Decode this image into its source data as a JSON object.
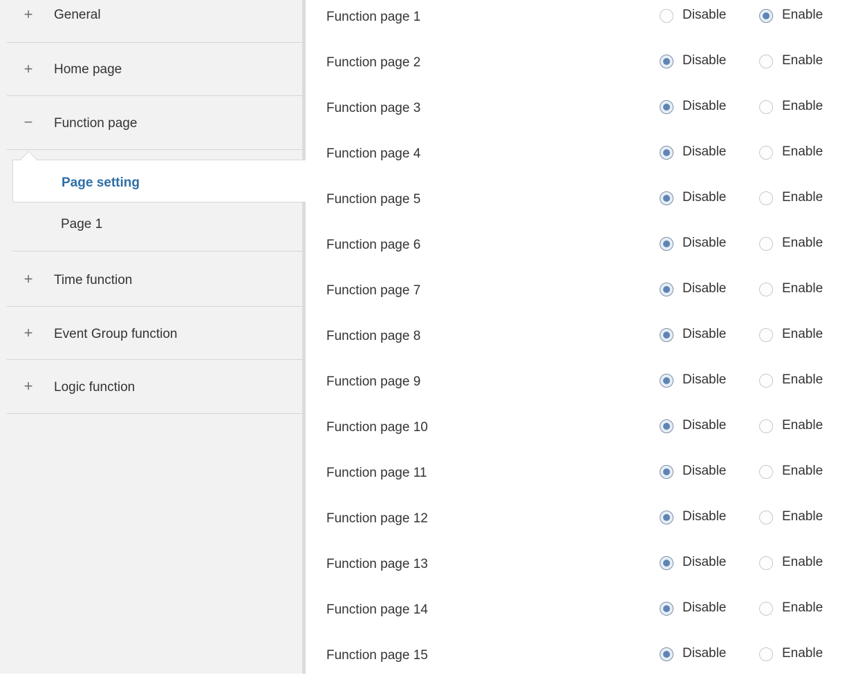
{
  "sidebar": {
    "items": [
      {
        "toggle": "+",
        "label": "General"
      },
      {
        "toggle": "+",
        "label": "Home page"
      },
      {
        "toggle": "−",
        "label": "Function page"
      },
      {
        "toggle": "+",
        "label": "Time function"
      },
      {
        "toggle": "+",
        "label": "Event Group function"
      },
      {
        "toggle": "+",
        "label": "Logic function"
      }
    ],
    "sub_items": [
      {
        "label": "Page setting",
        "selected": true
      },
      {
        "label": "Page 1",
        "selected": false
      }
    ]
  },
  "options": {
    "disable_label": "Disable",
    "enable_label": "Enable"
  },
  "rows": [
    {
      "label": "Function page 1",
      "value": "Enable"
    },
    {
      "label": "Function page 2",
      "value": "Disable"
    },
    {
      "label": "Function page 3",
      "value": "Disable"
    },
    {
      "label": "Function page 4",
      "value": "Disable"
    },
    {
      "label": "Function page 5",
      "value": "Disable"
    },
    {
      "label": "Function page 6",
      "value": "Disable"
    },
    {
      "label": "Function page 7",
      "value": "Disable"
    },
    {
      "label": "Function page 8",
      "value": "Disable"
    },
    {
      "label": "Function page 9",
      "value": "Disable"
    },
    {
      "label": "Function page 10",
      "value": "Disable"
    },
    {
      "label": "Function page 11",
      "value": "Disable"
    },
    {
      "label": "Function page 12",
      "value": "Disable"
    },
    {
      "label": "Function page 13",
      "value": "Disable"
    },
    {
      "label": "Function page 14",
      "value": "Disable"
    },
    {
      "label": "Function page 15",
      "value": "Disable"
    }
  ],
  "colors": {
    "selected_text": "#2e6fa7",
    "radio_dot": "#5f84b5",
    "sidebar_bg": "#f2f2f2"
  }
}
